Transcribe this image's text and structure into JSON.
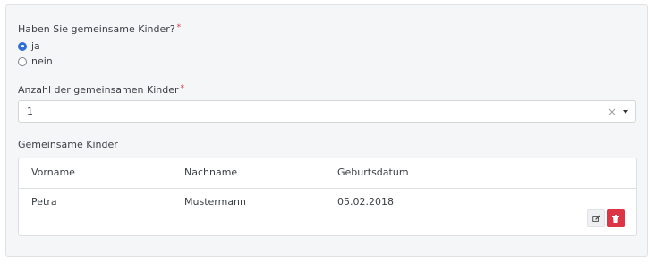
{
  "question_kids": {
    "label": "Haben Sie gemeinsame Kinder?",
    "required_mark": "*",
    "options": [
      {
        "label": "ja",
        "checked": true
      },
      {
        "label": "nein",
        "checked": false
      }
    ]
  },
  "kids_count": {
    "label": "Anzahl der gemeinsamen Kinder",
    "required_mark": "*",
    "value": "1",
    "clear_symbol": "×"
  },
  "children_table": {
    "label": "Gemeinsame Kinder",
    "columns": [
      "Vorname",
      "Nachname",
      "Geburtsdatum"
    ],
    "rows": [
      {
        "first_name": "Petra",
        "last_name": "Mustermann",
        "birth_date": "05.02.2018"
      }
    ],
    "actions": {
      "edit_icon": "edit-icon",
      "delete_icon": "trash-icon"
    }
  },
  "colors": {
    "accent": "#2f6fd6",
    "danger": "#dc3545",
    "panel_bg": "#f5f6f8"
  }
}
